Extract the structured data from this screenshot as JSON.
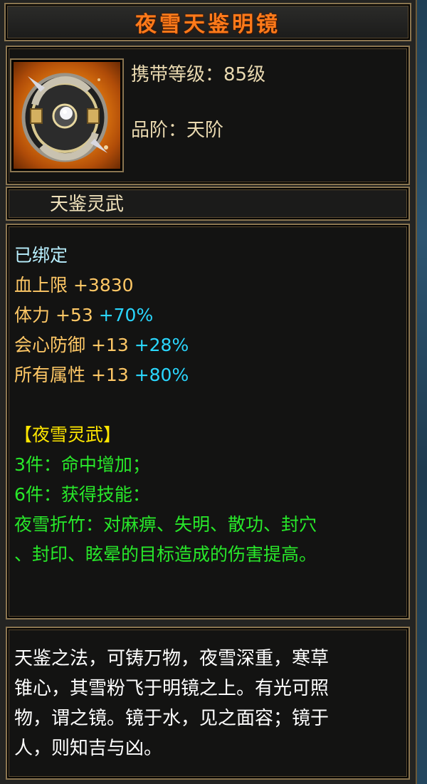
{
  "item": {
    "name": "夜雪天鉴明镜",
    "level_label": "携带等级：",
    "level_value": "85级",
    "grade_label": "品阶：",
    "grade_value": "天阶",
    "category": "天鉴灵武",
    "icon": "mirror-shield-icon"
  },
  "stats": {
    "bound": "已绑定",
    "lines": [
      {
        "name": "血上限",
        "value": "+3830",
        "percent": ""
      },
      {
        "name": "体力",
        "value": "+53",
        "percent": "+70%"
      },
      {
        "name": "会心防御",
        "value": "+13",
        "percent": "+28%"
      },
      {
        "name": "所有属性",
        "value": "+13",
        "percent": "+80%"
      }
    ]
  },
  "set": {
    "name": "【夜雪灵武】",
    "piece3": "3件：命中增加；",
    "piece6": "6件：获得技能：",
    "skill_line1": "夜雪折竹：对麻痹、失明、散功、封穴",
    "skill_line2": "、封印、眩晕的目标造成的伤害提高。"
  },
  "description": {
    "line1": "天鉴之法，可铸万物，夜雪深重，寒草",
    "line2": "锥心，其雪粉飞于明镜之上。有光可照",
    "line3": "物，谓之镜。镜于水，见之面容；镜于",
    "line4": "人，则知吉与凶。"
  },
  "colors": {
    "title": "#ff7a1a",
    "bound": "#b9f0ff",
    "stat": "#ffc866",
    "percent": "#2ad7ff",
    "set_name": "#ffe700",
    "set_text": "#28e82a",
    "border": "#8a7550"
  }
}
